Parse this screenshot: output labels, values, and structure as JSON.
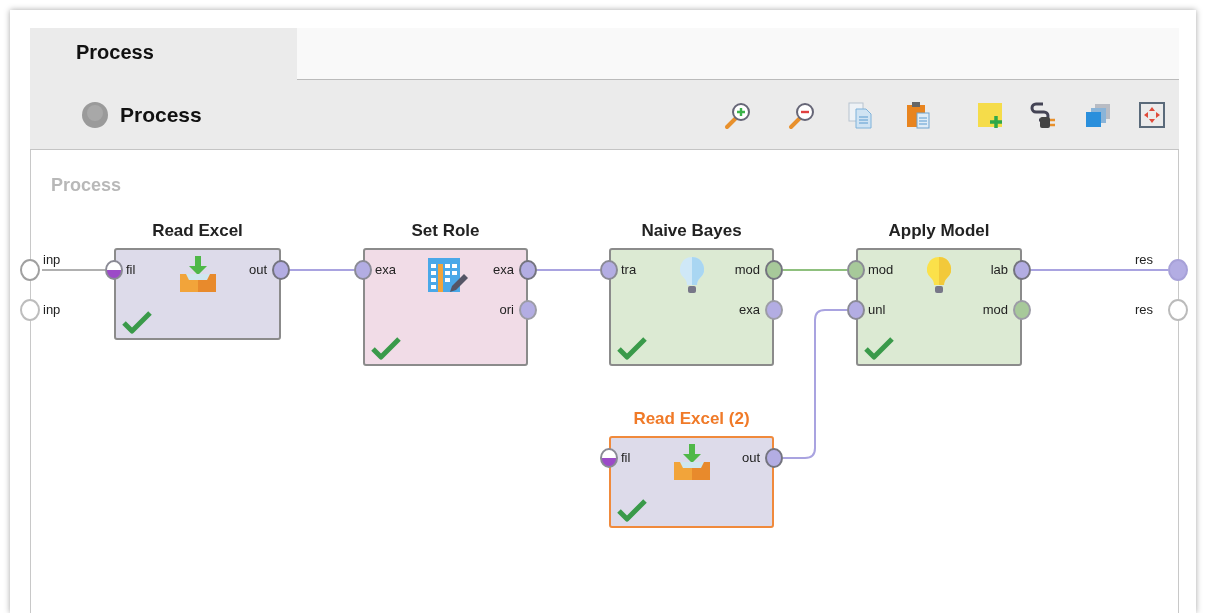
{
  "tabs": [
    {
      "label": "Process",
      "selected": true
    }
  ],
  "toolbar": {
    "title": "Process"
  },
  "canvas": {
    "label": "Process",
    "process_inputs": [
      {
        "label": "inp",
        "connected": true
      },
      {
        "label": "inp",
        "connected": false
      }
    ],
    "process_outputs": [
      {
        "label": "res",
        "connected": true
      },
      {
        "label": "res",
        "connected": false
      }
    ],
    "nodes": [
      {
        "title": "Read Excel",
        "kind": "read-excel",
        "selected": false,
        "ok": true,
        "inputs": [
          {
            "label": "fil",
            "kind": "file"
          }
        ],
        "outputs": [
          {
            "label": "out",
            "kind": "example",
            "connected": true
          }
        ]
      },
      {
        "title": "Set Role",
        "kind": "set-role",
        "selected": false,
        "ok": true,
        "inputs": [
          {
            "label": "exa",
            "kind": "example"
          }
        ],
        "outputs": [
          {
            "label": "exa",
            "kind": "example",
            "connected": true
          },
          {
            "label": "ori",
            "kind": "example",
            "connected": false
          }
        ]
      },
      {
        "title": "Naive Bayes",
        "kind": "naive-bayes",
        "selected": false,
        "ok": true,
        "inputs": [
          {
            "label": "tra",
            "kind": "example"
          }
        ],
        "outputs": [
          {
            "label": "mod",
            "kind": "model",
            "connected": true
          },
          {
            "label": "exa",
            "kind": "example",
            "connected": false
          }
        ]
      },
      {
        "title": "Apply Model",
        "kind": "apply-model",
        "selected": false,
        "ok": true,
        "inputs": [
          {
            "label": "mod",
            "kind": "model"
          },
          {
            "label": "unl",
            "kind": "example"
          }
        ],
        "outputs": [
          {
            "label": "lab",
            "kind": "example",
            "connected": true
          },
          {
            "label": "mod",
            "kind": "model",
            "connected": false
          }
        ]
      },
      {
        "title": "Read Excel (2)",
        "kind": "read-excel",
        "selected": true,
        "ok": true,
        "inputs": [
          {
            "label": "fil",
            "kind": "file"
          }
        ],
        "outputs": [
          {
            "label": "out",
            "kind": "example",
            "connected": true
          }
        ]
      }
    ]
  }
}
